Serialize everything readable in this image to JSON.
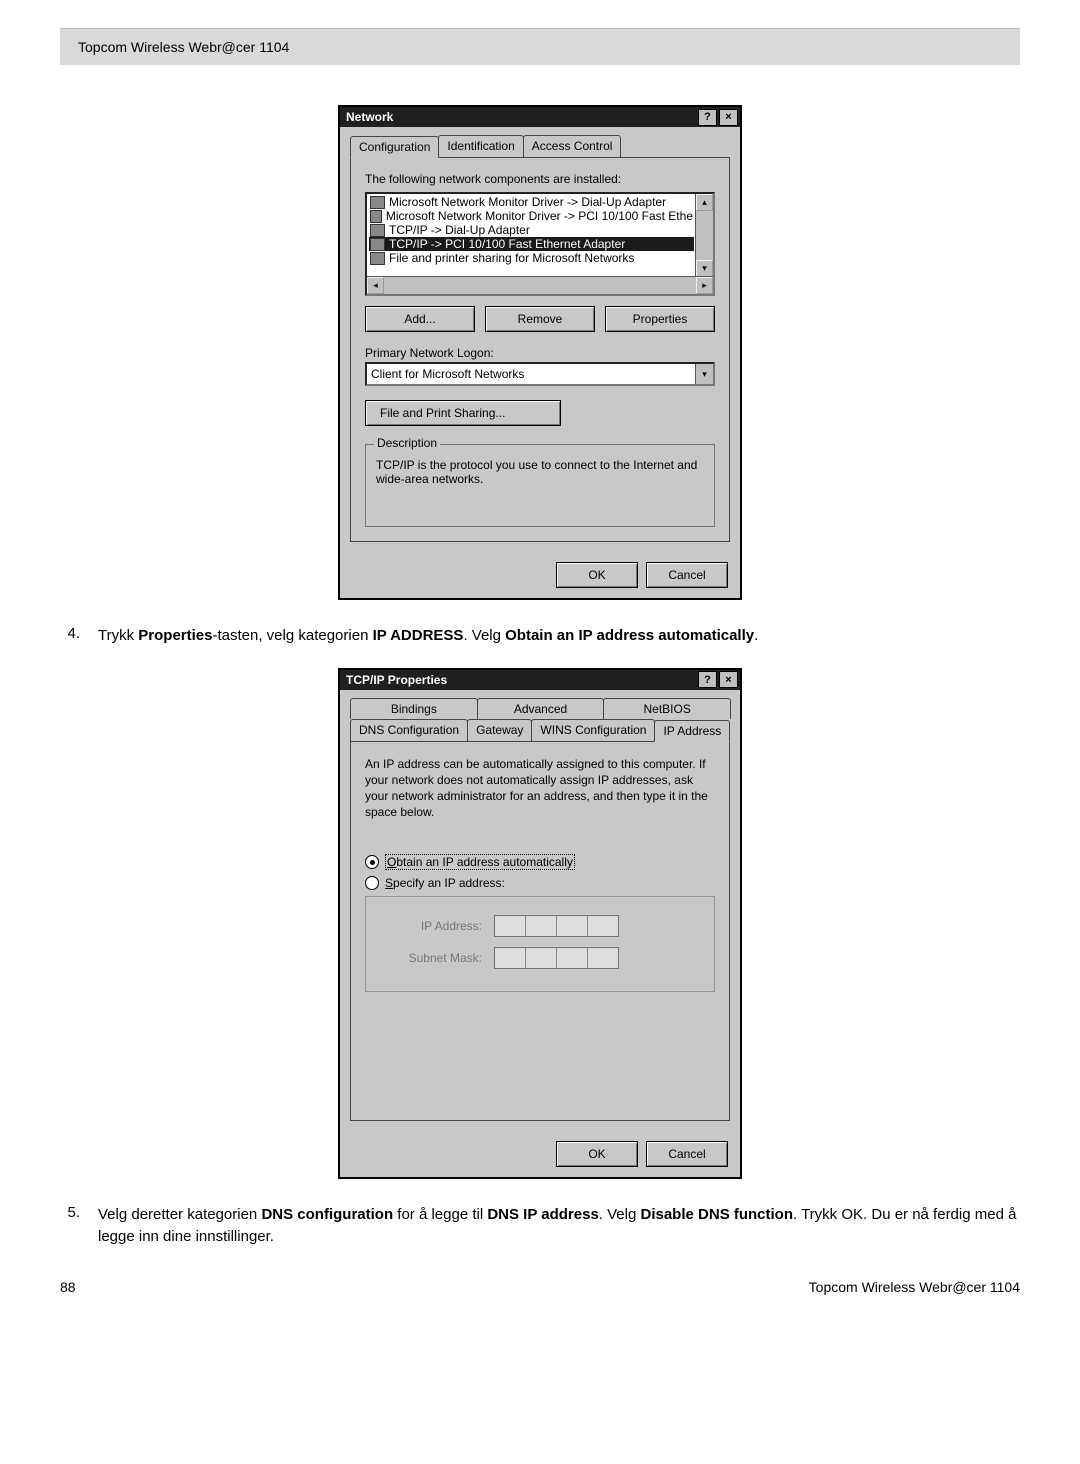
{
  "header": {
    "doc_title": "Topcom Wireless Webr@cer 1104"
  },
  "dialog1": {
    "title": "Network",
    "tabs": [
      "Configuration",
      "Identification",
      "Access Control"
    ],
    "components_label": "The following network components are installed:",
    "items": [
      "Microsoft Network Monitor Driver -> Dial-Up Adapter",
      "Microsoft Network Monitor Driver -> PCI 10/100 Fast Ethe",
      "TCP/IP -> Dial-Up Adapter",
      "TCP/IP -> PCI 10/100 Fast Ethernet Adapter",
      "File and printer sharing for Microsoft Networks"
    ],
    "selected_index": 3,
    "add": "Add...",
    "remove": "Remove",
    "properties": "Properties",
    "primary_logon_label": "Primary Network Logon:",
    "primary_logon_value": "Client for Microsoft Networks",
    "fps": "File and Print Sharing...",
    "description_label": "Description",
    "description_text": "TCP/IP is the protocol you use to connect to the Internet and wide-area networks.",
    "ok": "OK",
    "cancel": "Cancel"
  },
  "step4": {
    "num": "4.",
    "text_parts": [
      "Trykk ",
      "Properties",
      "-tasten, velg kategorien ",
      "IP ADDRESS",
      ". Velg ",
      "Obtain an IP address automatically",
      "."
    ]
  },
  "dialog2": {
    "title": "TCP/IP Properties",
    "tabs_row1": [
      "Bindings",
      "Advanced",
      "NetBIOS"
    ],
    "tabs_row2": [
      "DNS Configuration",
      "Gateway",
      "WINS Configuration",
      "IP Address"
    ],
    "info": "An IP address can be automatically assigned to this computer. If your network does not automatically assign IP addresses, ask your network administrator for an address, and then type it in the space below.",
    "radio_auto": "Obtain an IP address automatically",
    "radio_specify": "Specify an IP address:",
    "ip_label": "IP Address:",
    "subnet_label": "Subnet Mask:",
    "ok": "OK",
    "cancel": "Cancel"
  },
  "step5": {
    "num": "5.",
    "text_parts": [
      "Velg deretter kategorien ",
      "DNS configuration",
      " for å legge til ",
      "DNS IP address",
      ". Velg ",
      "Disable DNS function",
      ". Trykk OK. Du er nå ferdig med å legge inn dine innstillinger."
    ]
  },
  "footer": {
    "page_num": "88",
    "doc_title": "Topcom Wireless Webr@cer 1104"
  }
}
